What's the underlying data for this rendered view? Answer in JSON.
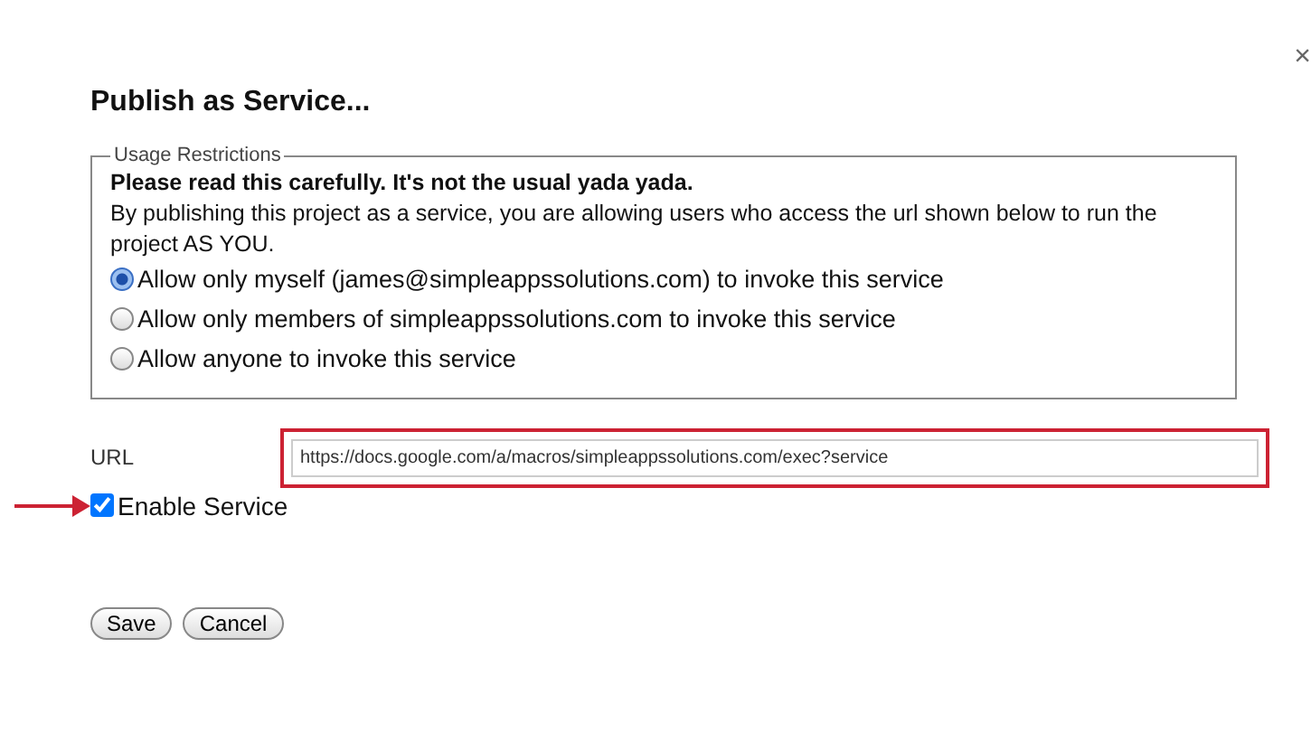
{
  "dialog": {
    "title": "Publish as Service...",
    "close": "×"
  },
  "usage_restrictions": {
    "legend": "Usage Restrictions",
    "warning": "Please read this carefully. It's not the usual yada yada.",
    "description": "By publishing this project as a service, you are allowing users who access the url shown below to run the project AS YOU.",
    "options": [
      {
        "label": "Allow only myself (james@simpleappssolutions.com) to invoke this service",
        "selected": true
      },
      {
        "label": "Allow only members of simpleappssolutions.com to invoke this service",
        "selected": false
      },
      {
        "label": "Allow anyone to invoke this service",
        "selected": false
      }
    ]
  },
  "url": {
    "label": "URL",
    "value": "https://docs.google.com/a/macros/simpleappssolutions.com/exec?service",
    "highlighted": true
  },
  "enable_service": {
    "label": "Enable Service",
    "checked": true,
    "highlighted": true
  },
  "buttons": [
    "Save",
    "Cancel"
  ]
}
